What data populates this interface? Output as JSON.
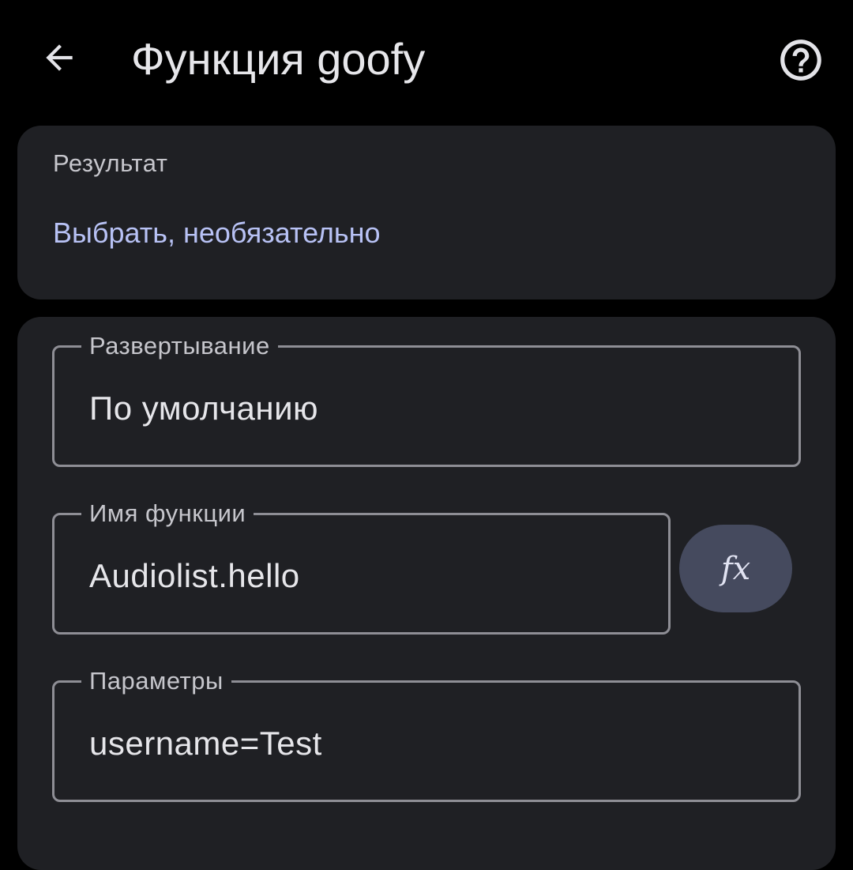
{
  "header": {
    "title": "Функция goofy",
    "back_icon": "arrow-back-icon",
    "help_icon": "help-circle-icon"
  },
  "result_card": {
    "label": "Результат",
    "select_link": "Выбрать, необязательно"
  },
  "form": {
    "deploy": {
      "label": "Развертывание",
      "value": "По умолчанию"
    },
    "function_name": {
      "label": "Имя функции",
      "value": "Audiolist.hello",
      "fx_button": "fx"
    },
    "params": {
      "label": "Параметры",
      "value": "username=Test"
    }
  },
  "colors": {
    "background": "#000000",
    "card": "#1f2024",
    "link": "#b8c2f5",
    "fx_button": "#454a5e",
    "outline": "#8e8e95"
  }
}
